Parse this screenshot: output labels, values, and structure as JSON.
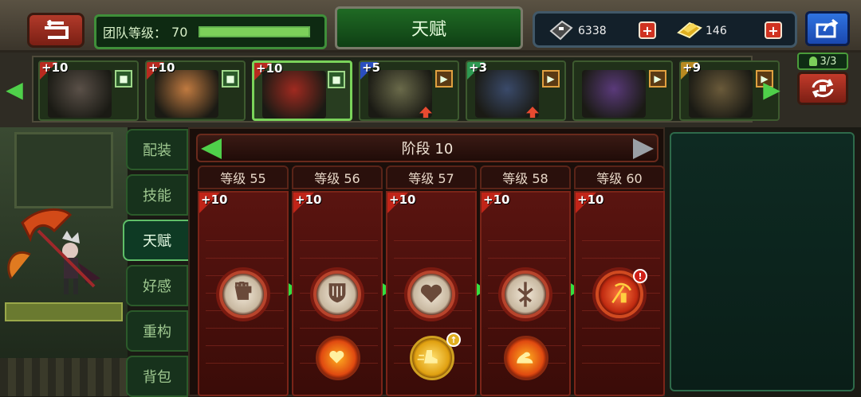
{
  "header": {
    "team_level_label": "团队等级：",
    "team_level_value": "70",
    "team_level_progress": 1.0,
    "title": "天赋"
  },
  "currency": {
    "gems": "6338",
    "gold": "146",
    "add_label": "+"
  },
  "roster": {
    "squad_count": "3/3",
    "heroes": [
      {
        "level": "+10",
        "tier_color": "#b82a1f",
        "role": "defender",
        "selected": false
      },
      {
        "level": "+10",
        "tier_color": "#b82a1f",
        "role": "defender",
        "selected": false
      },
      {
        "level": "+10",
        "tier_color": "#b82a1f",
        "role": "defender",
        "selected": true
      },
      {
        "level": "+5",
        "tier_color": "#2a4ec0",
        "role": "attacker",
        "upgrade": true
      },
      {
        "level": "+3",
        "tier_color": "#2e9a52",
        "role": "attacker",
        "upgrade": true
      },
      {
        "level": "",
        "tier_color": "",
        "role": "attacker"
      },
      {
        "level": "+9",
        "tier_color": "#b88a20",
        "role": "attacker"
      }
    ]
  },
  "side_tabs": [
    {
      "label": "配装",
      "active": false
    },
    {
      "label": "技能",
      "active": false
    },
    {
      "label": "天赋",
      "active": true
    },
    {
      "label": "好感",
      "active": false
    },
    {
      "label": "重构",
      "active": false
    },
    {
      "label": "背包",
      "active": false
    }
  ],
  "stage": {
    "label": "阶段 10"
  },
  "talent_columns": [
    {
      "header": "等级 55",
      "plus": "+10",
      "main_icon": "fist-icon",
      "sub_icon": null
    },
    {
      "header": "等级 56",
      "plus": "+10",
      "main_icon": "shield-icon",
      "sub_icon": "heart-burst-icon"
    },
    {
      "header": "等级 57",
      "plus": "+10",
      "main_icon": "heart-icon",
      "sub_icon": "boot-speed-icon"
    },
    {
      "header": "等级 58",
      "plus": "+10",
      "main_icon": "sword-icon",
      "sub_icon": "flex-arm-icon"
    },
    {
      "header": "等级 60",
      "plus": "+10",
      "main_icon": "scythe-icon",
      "sub_icon": null
    }
  ],
  "colors": {
    "accent_green": "#4fd04a",
    "danger_red": "#d03220",
    "panel_red": "#5a1410"
  }
}
